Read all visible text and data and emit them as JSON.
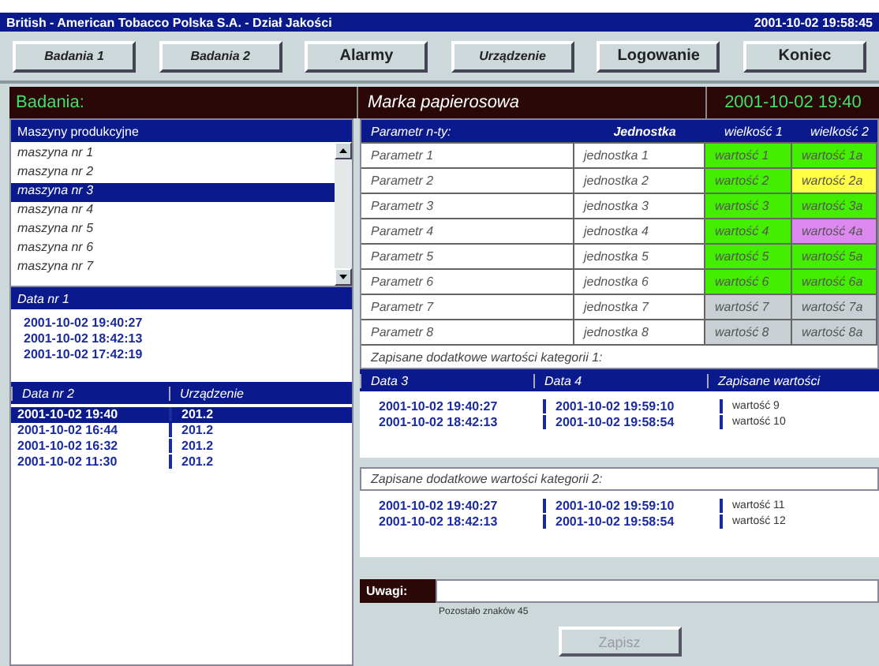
{
  "window": {
    "title": "British - American Tobacco Polska S.A. - Dział Jakości",
    "clock": "2001-10-02 19:58:45"
  },
  "toolbar": [
    {
      "label": "Badania 1",
      "italic": true
    },
    {
      "label": "Badania 2",
      "italic": true
    },
    {
      "label": "Alarmy",
      "italic": false
    },
    {
      "label": "Urządzenie",
      "italic": true
    },
    {
      "label": "Logowanie",
      "italic": false
    },
    {
      "label": "Koniec",
      "italic": false
    }
  ],
  "header": {
    "section": "Badania:",
    "brand": "Marka papierosowa",
    "datetime": "2001-10-02 19:40"
  },
  "machines": {
    "title": "Maszyny produkcyjne",
    "items": [
      {
        "label": "maszyna nr 1",
        "selected": false
      },
      {
        "label": "maszyna nr 2",
        "selected": false
      },
      {
        "label": "maszyna nr 3",
        "selected": true
      },
      {
        "label": "maszyna nr 4",
        "selected": false
      },
      {
        "label": "maszyna nr 5",
        "selected": false
      },
      {
        "label": "maszyna nr 6",
        "selected": false
      },
      {
        "label": "maszyna nr 7",
        "selected": false
      }
    ]
  },
  "dates1": {
    "title": "Data nr 1",
    "items": [
      "2001-10-02 19:40:27",
      "2001-10-02 18:42:13",
      "2001-10-02 17:42:19"
    ]
  },
  "dates2": {
    "columns": [
      "Data nr 2",
      "Urządzenie"
    ],
    "rows": [
      {
        "date": "2001-10-02 19:40",
        "device": "201.2",
        "selected": true
      },
      {
        "date": "2001-10-02 16:44",
        "device": "201.2",
        "selected": false
      },
      {
        "date": "2001-10-02 16:32",
        "device": "201.2",
        "selected": false
      },
      {
        "date": "2001-10-02 11:30",
        "device": "201.2",
        "selected": false
      }
    ]
  },
  "params": {
    "columns": [
      "Parametr n-ty:",
      "Jednostka",
      "wielkość 1",
      "wielkość 2"
    ],
    "rows": [
      {
        "name": "Parametr 1",
        "unit": "jednostka 1",
        "v1": {
          "text": "wartość 1",
          "color": "#44ee00"
        },
        "v2": {
          "text": "wartość 1a",
          "color": "#44ee00"
        }
      },
      {
        "name": "Parametr 2",
        "unit": "jednostka 2",
        "v1": {
          "text": "wartość 2",
          "color": "#44ee00"
        },
        "v2": {
          "text": "wartość 2a",
          "color": "#ffff44"
        }
      },
      {
        "name": "Parametr 3",
        "unit": "jednostka 3",
        "v1": {
          "text": "wartość 3",
          "color": "#44ee00"
        },
        "v2": {
          "text": "wartość 3a",
          "color": "#44ee00"
        }
      },
      {
        "name": "Parametr 4",
        "unit": "jednostka 4",
        "v1": {
          "text": "wartość 4",
          "color": "#44ee00"
        },
        "v2": {
          "text": "wartość 4a",
          "color": "#dd88ee"
        }
      },
      {
        "name": "Parametr 5",
        "unit": "jednostka 5",
        "v1": {
          "text": "wartość 5",
          "color": "#44ee00"
        },
        "v2": {
          "text": "wartość 5a",
          "color": "#44ee00"
        }
      },
      {
        "name": "Parametr 6",
        "unit": "jednostka 6",
        "v1": {
          "text": "wartość 6",
          "color": "#44ee00"
        },
        "v2": {
          "text": "wartość 6a",
          "color": "#44ee00"
        }
      },
      {
        "name": "Parametr 7",
        "unit": "jednostka 7",
        "v1": {
          "text": "wartość 7",
          "color": "#c8d0d4"
        },
        "v2": {
          "text": "wartość 7a",
          "color": "#c8d0d4"
        }
      },
      {
        "name": "Parametr 8",
        "unit": "jednostka 8",
        "v1": {
          "text": "wartość 8",
          "color": "#c8d0d4"
        },
        "v2": {
          "text": "wartość 8a",
          "color": "#c8d0d4"
        }
      }
    ]
  },
  "extra1": {
    "title": "Zapisane dodatkowe wartości kategorii 1:",
    "columns": [
      "Data 3",
      "Data 4",
      "Zapisane wartości"
    ],
    "rows": [
      {
        "d3": "2001-10-02 19:40:27",
        "d4": "2001-10-02 19:59:10",
        "value": "wartość 9"
      },
      {
        "d3": "2001-10-02 18:42:13",
        "d4": "2001-10-02 19:58:54",
        "value": "wartość 10"
      }
    ]
  },
  "extra2": {
    "title": "Zapisane dodatkowe wartości kategorii 2:",
    "rows": [
      {
        "d3": "2001-10-02 19:40:27",
        "d4": "2001-10-02 19:59:10",
        "value": "wartość 11"
      },
      {
        "d3": "2001-10-02 18:42:13",
        "d4": "2001-10-02 19:58:54",
        "value": "wartość 12"
      }
    ]
  },
  "notes": {
    "label": "Uwagi:",
    "remaining": "Pozostało znaków 45",
    "save": "Zapisz",
    "save_disabled": true
  }
}
